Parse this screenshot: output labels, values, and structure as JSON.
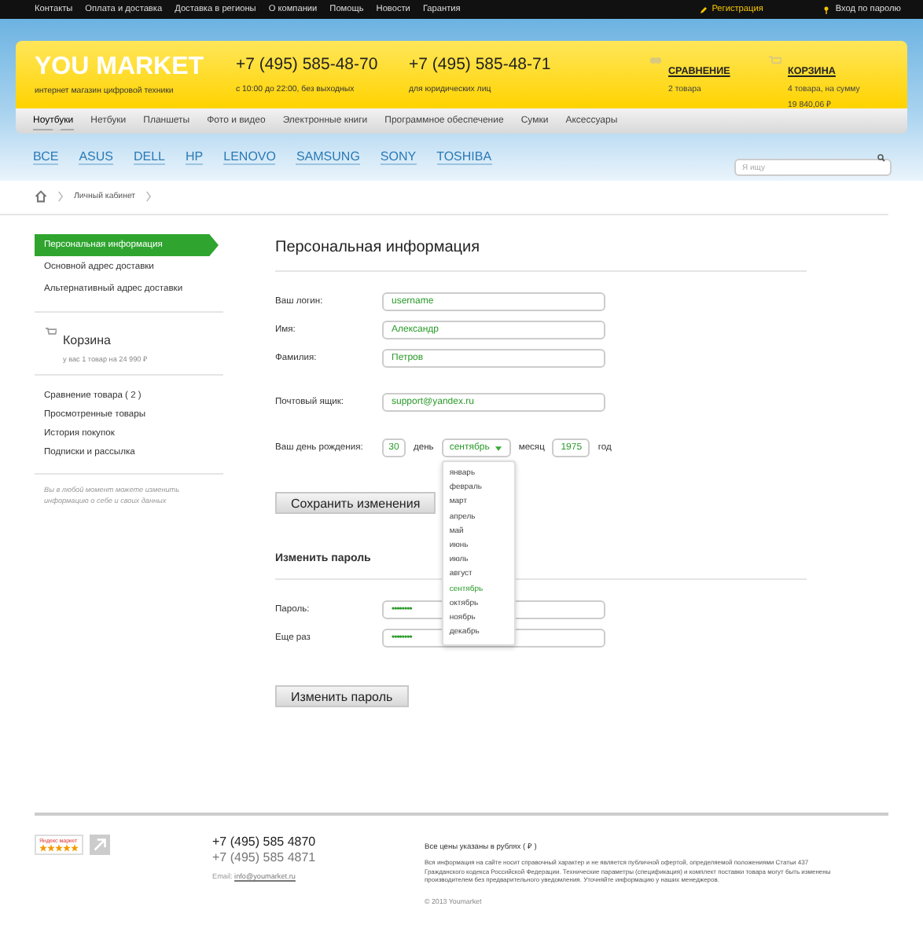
{
  "top_bar": {
    "links": [
      "Контакты",
      "Оплата и доставка",
      "Доставка в регионы",
      "О компании",
      "Помощь",
      "Новости",
      "Гарантия"
    ],
    "register": "Регистрация",
    "login": "Вход по паролю"
  },
  "header": {
    "logo": "YOU MARKET",
    "tagline": "интернет магазин цифровой техники",
    "phones": [
      {
        "number": "+7 (495) 585-48-70",
        "note": "с 10:00 до 22:00, без выходных"
      },
      {
        "number": "+7 (495) 585-48-71",
        "note": "для юридических лиц"
      }
    ],
    "compare": {
      "title": "СРАВНЕНИЕ",
      "lines": [
        "2 товара"
      ]
    },
    "cart": {
      "title": "КОРЗИНА",
      "lines": [
        "4 товара, на сумму",
        "19 840,06 ₽"
      ]
    }
  },
  "categories": [
    {
      "label": "Ноутбуки",
      "selected": true
    },
    {
      "label": "Нетбуки",
      "selected": false
    },
    {
      "label": "Планшеты",
      "selected": false
    },
    {
      "label": "Фото и видео",
      "selected": false
    },
    {
      "label": "Электронные книги",
      "selected": false
    },
    {
      "label": "Программное обеспечение",
      "selected": false
    },
    {
      "label": "Сумки",
      "selected": false
    },
    {
      "label": "Аксессуары",
      "selected": false
    }
  ],
  "brands": [
    "ВСЕ",
    "ASUS",
    "DELL",
    "HP",
    "LENOVO",
    "SAMSUNG",
    "SONY",
    "TOSHIBA"
  ],
  "search": {
    "placeholder": "Я ищу"
  },
  "breadcrumb": [
    "Личный кабинет"
  ],
  "sidebar": {
    "account_items": [
      {
        "label": "Персональная информация",
        "selected": true
      },
      {
        "label": "Основной адрес доставки",
        "selected": false
      },
      {
        "label": "Альтернативный адрес доставки",
        "selected": false
      }
    ],
    "cart": {
      "title": "Корзина",
      "note": "у вас 1 товар на 24 990 ₽"
    },
    "links": [
      "Сравнение товара ( 2 )",
      "Просмотренные товары",
      "История покупок",
      "Подписки и рассылка"
    ],
    "hint": "Вы в любой момент можете изменить информацию о себе и своих данных"
  },
  "personal": {
    "title": "Персональная информация",
    "fields": [
      {
        "label": "Ваш логин:",
        "value": "username"
      },
      {
        "label": "Имя:",
        "value": "Александр"
      },
      {
        "label": "Фамилия:",
        "value": "Петров"
      },
      {
        "label": "Почтовый ящик:",
        "value": "support@yandex.ru"
      }
    ],
    "birthday": {
      "label": "Ваш день рождения:",
      "day": "30",
      "day_unit": "день",
      "month": "сентябрь",
      "month_unit": "месяц",
      "year": "1975",
      "year_unit": "год",
      "months": [
        {
          "label": "январь",
          "selected": false
        },
        {
          "label": "февраль",
          "selected": false
        },
        {
          "label": "март",
          "selected": false
        },
        {
          "label": "апрель",
          "selected": false
        },
        {
          "label": "май",
          "selected": false
        },
        {
          "label": "июнь",
          "selected": false
        },
        {
          "label": "июль",
          "selected": false
        },
        {
          "label": "август",
          "selected": false
        },
        {
          "label": "сентябрь",
          "selected": true
        },
        {
          "label": "октябрь",
          "selected": false
        },
        {
          "label": "ноябрь",
          "selected": false
        },
        {
          "label": "декабрь",
          "selected": false
        }
      ]
    },
    "save_button": "Сохранить изменения"
  },
  "password": {
    "title": "Изменить пароль",
    "fields": [
      {
        "label": "Пароль:",
        "value": "••••••••"
      },
      {
        "label": "Еще раз",
        "value": "••••••••"
      }
    ],
    "button": "Изменить пароль"
  },
  "footer": {
    "rating": {
      "label": "Яндекс маркет",
      "stars": 5
    },
    "phones": [
      "+7 (495) 585 4870",
      "+7 (495) 585 4871"
    ],
    "email_label": "Email:",
    "email": "info@youmarket.ru",
    "prices_note": "Все цены указаны в рублях ( ₽ )",
    "disclaimer": "Вся информация на сайте носит справочный характер и не является публичной офертой, определяемой положениями Статьи 437 Гражданского кодекса Российской Федерации. Технические параметры (спецификация) и комплект поставки товара могут быть изменены производителем без предварительного уведомления. Уточняйте информацию у наших менеджеров.",
    "copyright": "© 2013 Youmarket"
  }
}
